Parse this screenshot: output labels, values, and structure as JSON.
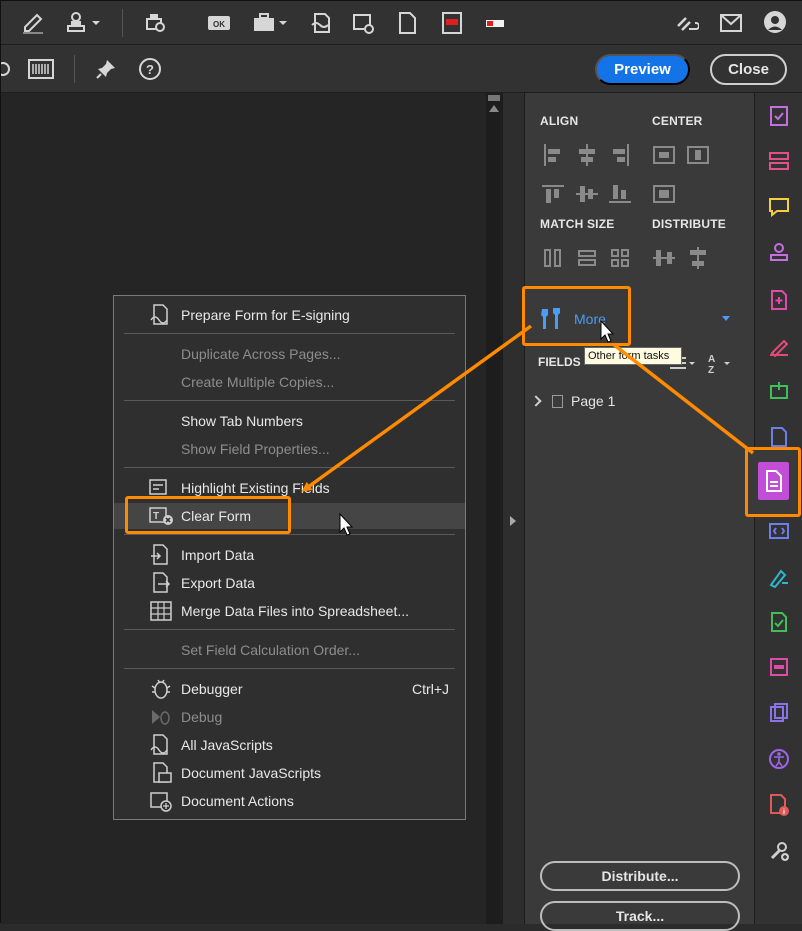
{
  "toolbar": {
    "preview_label": "Preview",
    "close_label": "Close",
    "ok_label": "OK"
  },
  "panel": {
    "align_heading": "ALIGN",
    "center_heading": "CENTER",
    "match_size_heading": "MATCH SIZE",
    "distribute_heading": "DISTRIBUTE",
    "more_label": "More",
    "more_tooltip": "Other form tasks",
    "fields_label": "FIELDS",
    "tree_page": "Page 1",
    "distribute_button": "Distribute...",
    "track_button": "Track..."
  },
  "menu": {
    "items": [
      {
        "label": "Prepare Form for E-signing",
        "enabled": true
      },
      {
        "label": "Duplicate Across Pages...",
        "enabled": false
      },
      {
        "label": "Create Multiple Copies...",
        "enabled": false
      },
      {
        "label": "Show Tab Numbers",
        "enabled": true
      },
      {
        "label": "Show Field Properties...",
        "enabled": false
      },
      {
        "label": "Highlight Existing Fields",
        "enabled": true
      },
      {
        "label": "Clear Form",
        "enabled": true
      },
      {
        "label": "Import Data",
        "enabled": true
      },
      {
        "label": "Export Data",
        "enabled": true
      },
      {
        "label": "Merge Data Files into Spreadsheet...",
        "enabled": true
      },
      {
        "label": "Set Field Calculation Order...",
        "enabled": false
      },
      {
        "label": "Debugger",
        "enabled": true,
        "shortcut": "Ctrl+J"
      },
      {
        "label": "Debug",
        "enabled": false
      },
      {
        "label": "All JavaScripts",
        "enabled": true
      },
      {
        "label": "Document JavaScripts",
        "enabled": true
      },
      {
        "label": "Document Actions",
        "enabled": true
      }
    ]
  },
  "rail": {
    "icons": [
      "fill-sign-icon",
      "organize-pages-icon",
      "comment-icon",
      "stamp-icon",
      "create-pdf-icon",
      "request-signature-icon",
      "print-production-icon",
      "protect-icon",
      "prepare-form-icon",
      "export-structure-icon",
      "certificates-icon",
      "send-for-review-icon",
      "redact-icon",
      "combine-files-icon",
      "accessibility-icon",
      "pdf-standards-icon",
      "more-tools-icon"
    ]
  },
  "colors": {
    "accent_blue": "#1473e6",
    "highlight_orange": "#ff8a00",
    "active_tool_purple": "#c24dd6"
  }
}
